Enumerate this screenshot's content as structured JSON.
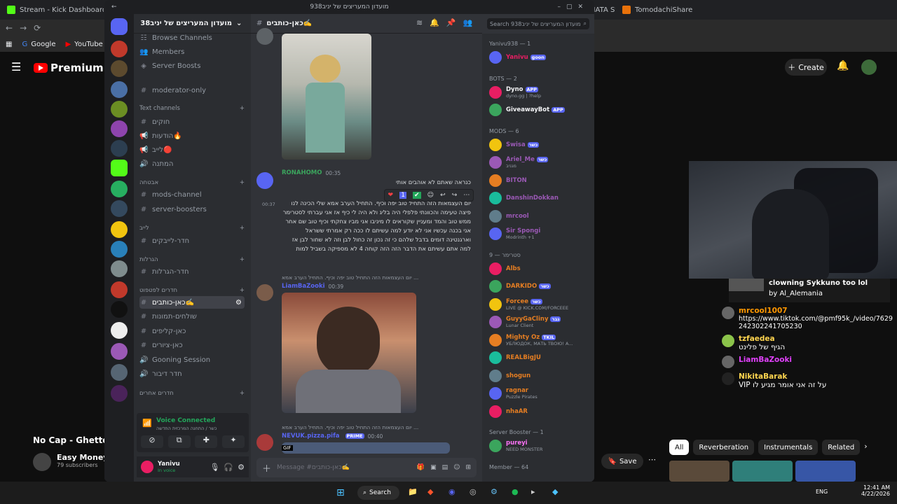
{
  "browser": {
    "tabs": [
      {
        "title": "Stream - Kick Dashboard",
        "color": "#53fc18"
      },
      {
        "title": "",
        "color": "#555555"
      },
      {
        "title": "Buy cheap PRAGMATA Steam Key",
        "color": "#f5a623"
      },
      {
        "title": "TomodachiShare",
        "color": "#e8710a"
      }
    ],
    "bookmarks": [
      "Google",
      "YouTube"
    ]
  },
  "youtube": {
    "logo": "Premium",
    "logo_region": "IL",
    "create_label": "Create",
    "stream_caption_title": "clowning Sykkuno too lol",
    "stream_caption_by": "by Al_Alemania",
    "chat": [
      {
        "name": "mrcool1007",
        "color": "#ff9800",
        "text": "https://www.tiktok.com/@pmf95k_/video/7629242302241705230"
      },
      {
        "name": "tzfaedea",
        "color": "#ffd54f",
        "text": "הגיף של פלינט"
      },
      {
        "name": "LiamBaZooki",
        "color": "#e040fb",
        "text": ""
      },
      {
        "name": "NikitaBarak",
        "color": "#ffd54f",
        "text": "VIP על זה אני אומר מגיע לו"
      }
    ],
    "video_title": "No Cap - Ghetto A",
    "channel_name": "Easy Money S",
    "subscribers": "79 subscribers",
    "save_label": "Save",
    "chips": [
      "All",
      "Reverberation",
      "Instrumentals",
      "Related"
    ]
  },
  "discord": {
    "window_title": "מועדון המעריצים של יניב938",
    "server_name": "מועדון המעריצים של יניב938",
    "channel_header": "כאן-כותבים✍️",
    "search_placeholder": "Search מועדון המעריצים של יניב938",
    "top_items": [
      "Browse Channels",
      "Members",
      "Server Boosts"
    ],
    "channels": [
      {
        "type": "channel",
        "name": "moderator-only",
        "active": false
      },
      {
        "type": "category",
        "name": "Text channels"
      },
      {
        "type": "channel",
        "name": "חוקים",
        "active": false
      },
      {
        "type": "channel",
        "name": "הודעות🔥",
        "active": false
      },
      {
        "type": "channel",
        "name": "לייב🔴",
        "active": false
      },
      {
        "type": "channel",
        "name": "המתנה",
        "active": false
      },
      {
        "type": "category",
        "name": "אבטחה"
      },
      {
        "type": "channel",
        "name": "mods-channel",
        "active": false
      },
      {
        "type": "channel",
        "name": "server-boosters",
        "active": false
      },
      {
        "type": "category",
        "name": "לייב"
      },
      {
        "type": "channel",
        "name": "חדר-לייבקים",
        "active": false
      },
      {
        "type": "category",
        "name": "הגרלות"
      },
      {
        "type": "channel",
        "name": "חדר-הגרלות",
        "active": false
      },
      {
        "type": "category",
        "name": "חדרים לפטפוט"
      },
      {
        "type": "channel",
        "name": "כאן-כותבים✍️",
        "active": true
      },
      {
        "type": "channel",
        "name": "שולחים-תמונות",
        "active": false
      },
      {
        "type": "channel",
        "name": "כאן-קליפים",
        "active": false
      },
      {
        "type": "channel",
        "name": "כאן-ציורים",
        "active": false
      },
      {
        "type": "channel",
        "name": "Gooning Session",
        "active": false
      },
      {
        "type": "channel",
        "name": "חדר דיבור",
        "active": false
      },
      {
        "type": "category",
        "name": "חדרים אחרים"
      }
    ],
    "voice": {
      "status": "Voice Connected",
      "detail": "כשר / התחנה המרכזית החדשה"
    },
    "user": {
      "name": "Yanivu",
      "status": "In voice"
    },
    "messages": [
      {
        "author": "RONAHOMO",
        "time": "00:35",
        "color": "#3ba55d",
        "lines": [
          "כנראה שאתם לא אוהבים אותי",
          "זה ממש פגע בי"
        ],
        "time2": "00:37",
        "body": "יום העצמאות הזה התחיל טוב יפה וכיף. התחיל הערב אמא שלי הכינה לנו פיצה טעימה והכוונתי פלפלי היה בליג ולא היה לי כיף אז אני עברתי לסטרימר ממש טוב והמד ומעניין שקוראים לו מיניבו אני מביו צחקתי וכיף טוב שם אחר אני בכנה עכשיו אני לא יודע למה עשיתם לו ככה רק אמרתי ששראל וארגנטינה דומים בדבל שלהם כי זה נכון זה כחול לבן וזה לא שחור לבן אז למה אתם עשיתם את הדבר הזה הזה קוחה 4 לא מספיקה בשביל למות"
      },
      {
        "author": "LiamBaZooki",
        "time": "00:39",
        "color": "#5865f2",
        "reply": "יום העצמאות הזה התחיל טוב יפה וכיף. התחיל הערב אמא ..."
      },
      {
        "author": "NEVUK.pizza.pifa",
        "time": "00:40",
        "color": "#5865f2",
        "reply": "יום העצמאות הזה התחיל טוב יפה וכיף. התחיל הערב אמא ...",
        "badge": "PRIME"
      }
    ],
    "reactions": [
      "❤",
      "1",
      "✔"
    ],
    "input_placeholder": "Message #כאן-כותבים✍️",
    "member_groups": [
      {
        "title": "Yanivu938 — 1",
        "members": [
          {
            "name": "Yanivu",
            "color": "#e91e63",
            "sub": "",
            "tag": "goon"
          }
        ]
      },
      {
        "title": "BOTS — 2",
        "members": [
          {
            "name": "Dyno",
            "color": "#f2f3f5",
            "sub": "dyno.gg | ?help",
            "tag": "APP"
          },
          {
            "name": "GiveawayBot",
            "color": "#f2f3f5",
            "sub": "",
            "tag": "APP"
          }
        ]
      },
      {
        "title": "MODS — 6",
        "members": [
          {
            "name": "Swisa",
            "color": "#9b59b6",
            "sub": "",
            "tag": "כשר"
          },
          {
            "name": "Ariel_Me",
            "color": "#9b59b6",
            "sub": "מגניב",
            "tag": "כשר"
          },
          {
            "name": "BITON",
            "color": "#9b59b6",
            "sub": "",
            "tag": ""
          },
          {
            "name": "DanshinDokkan",
            "color": "#9b59b6",
            "sub": "",
            "tag": ""
          },
          {
            "name": "mrcool",
            "color": "#9b59b6",
            "sub": "",
            "tag": ""
          },
          {
            "name": "Sir Spongi",
            "color": "#9b59b6",
            "sub": "Modrinth +1",
            "tag": ""
          }
        ]
      },
      {
        "title": "סטרימר — 9",
        "members": [
          {
            "name": "Albs",
            "color": "#e67e22",
            "sub": "",
            "tag": ""
          },
          {
            "name": "DARKIDO",
            "color": "#e67e22",
            "sub": "",
            "tag": "כשר"
          },
          {
            "name": "Forcee",
            "color": "#e67e22",
            "sub": "LIVE @ KICK.COM/FORCEEE",
            "tag": "כשר"
          },
          {
            "name": "GuyyGaCliny",
            "color": "#e67e22",
            "sub": "Lunar Client",
            "tag": "גבר"
          },
          {
            "name": "Mighty Oz",
            "color": "#e67e22",
            "sub": "УБЛЮДОК, МАТЬ ТВОЮ! А...",
            "tag": "TKIL"
          },
          {
            "name": "REALBigJU",
            "color": "#e67e22",
            "sub": "",
            "tag": ""
          },
          {
            "name": "shogun",
            "color": "#e67e22",
            "sub": "",
            "tag": ""
          },
          {
            "name": "ragnar",
            "color": "#e67e22",
            "sub": "Puzzle Pirates",
            "tag": ""
          },
          {
            "name": "nhaAR",
            "color": "#e67e22",
            "sub": "",
            "tag": ""
          }
        ]
      },
      {
        "title": "Server Booster — 1",
        "members": [
          {
            "name": "pureyi",
            "color": "#ff73fa",
            "sub": "NEED MONSTER",
            "tag": ""
          }
        ]
      },
      {
        "title": "Member — 64",
        "members": []
      }
    ]
  },
  "taskbar": {
    "search_label": "Search",
    "time": "12:41 AM",
    "date": "4/22/2026",
    "lang": "ENG"
  },
  "colors": {
    "discord_bg": "#313338",
    "sidebar_bg": "#2b2d31",
    "guild_bg": "#1e1f22",
    "youtube_bg": "#0f0f0f"
  }
}
